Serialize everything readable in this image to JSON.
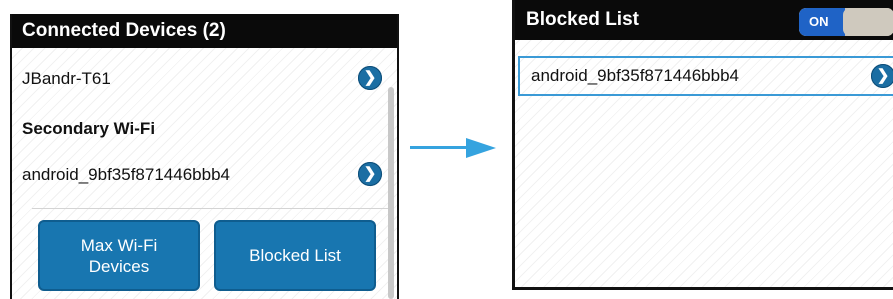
{
  "connected": {
    "title": "Connected Devices (2)",
    "devices": [
      {
        "name": "JBandr-T61"
      },
      {
        "name": "android_9bf35f871446bbb4"
      }
    ],
    "section_label": "Secondary Wi-Fi",
    "buttons": {
      "max_wifi": "Max Wi-Fi\nDevices",
      "blocked_list": "Blocked List"
    }
  },
  "blocked": {
    "title": "Blocked List",
    "toggle_label": "ON",
    "items": [
      {
        "name": "android_9bf35f871446bbb4"
      }
    ]
  },
  "icons": {
    "chevron": "chevron-right-icon",
    "arrow": "arrow-right-icon"
  },
  "colors": {
    "accent_blue": "#1876b0",
    "arrow": "#35a3df",
    "selection_border": "#3b9ad6",
    "toggle_on": "#1f63c6"
  }
}
